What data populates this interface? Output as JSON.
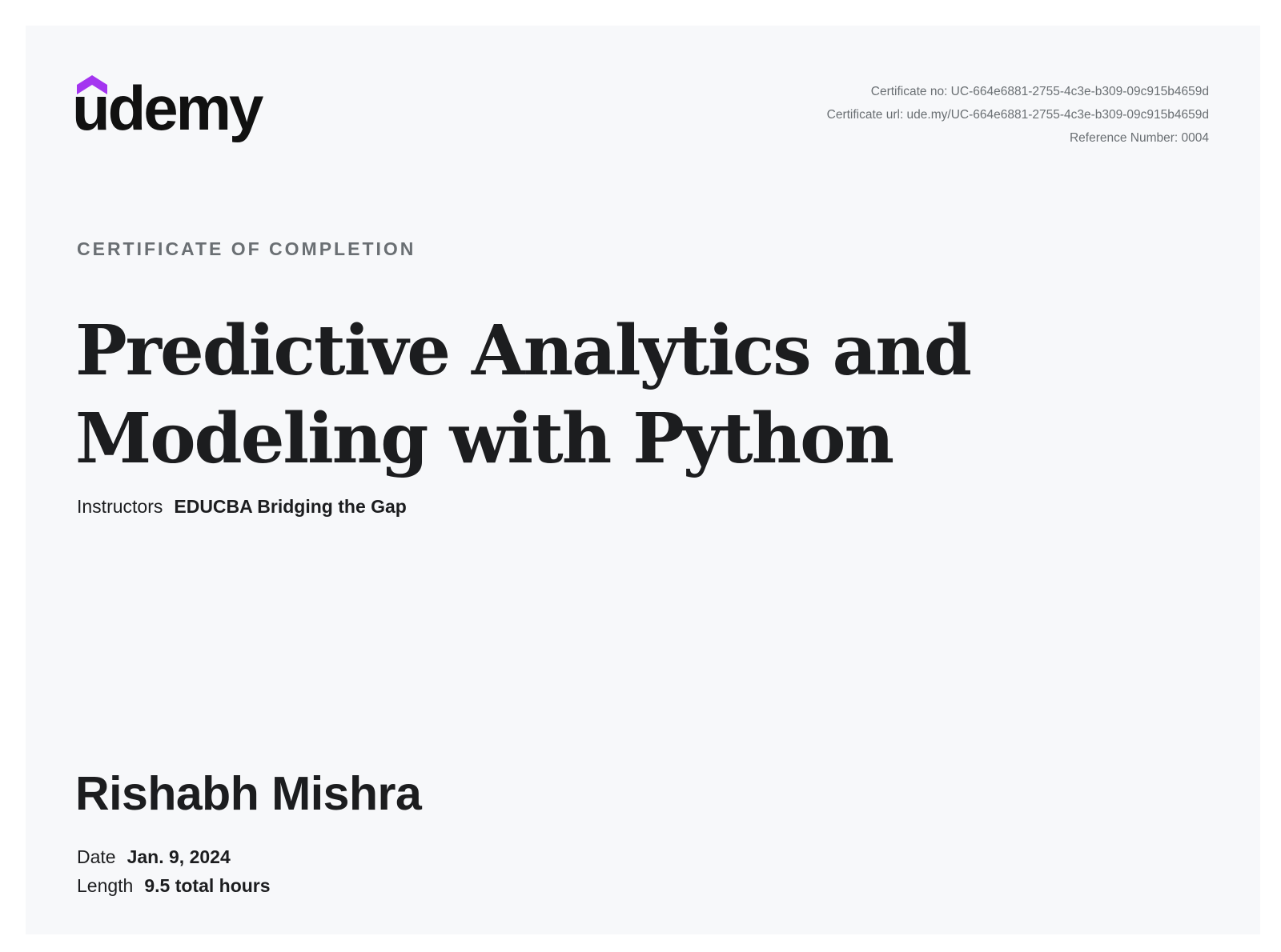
{
  "brand": {
    "logo_text": "udemy",
    "accent_color": "#a435f0",
    "icon": "graduation-cap-icon"
  },
  "meta": {
    "certificate_no": "Certificate no: UC-664e6881-2755-4c3e-b309-09c915b4659d",
    "certificate_url": "Certificate url: ude.my/UC-664e6881-2755-4c3e-b309-09c915b4659d",
    "reference_number": "Reference Number: 0004"
  },
  "certificate": {
    "eyebrow": "CERTIFICATE OF COMPLETION",
    "title_line1": "Predictive Analytics and",
    "title_line2": "Modeling with Python",
    "instructors_label": "Instructors",
    "instructors_value": "EDUCBA Bridging the Gap",
    "recipient": "Rishabh Mishra",
    "date_label": "Date",
    "date_value": "Jan. 9, 2024",
    "length_label": "Length",
    "length_value": "9.5 total hours"
  }
}
